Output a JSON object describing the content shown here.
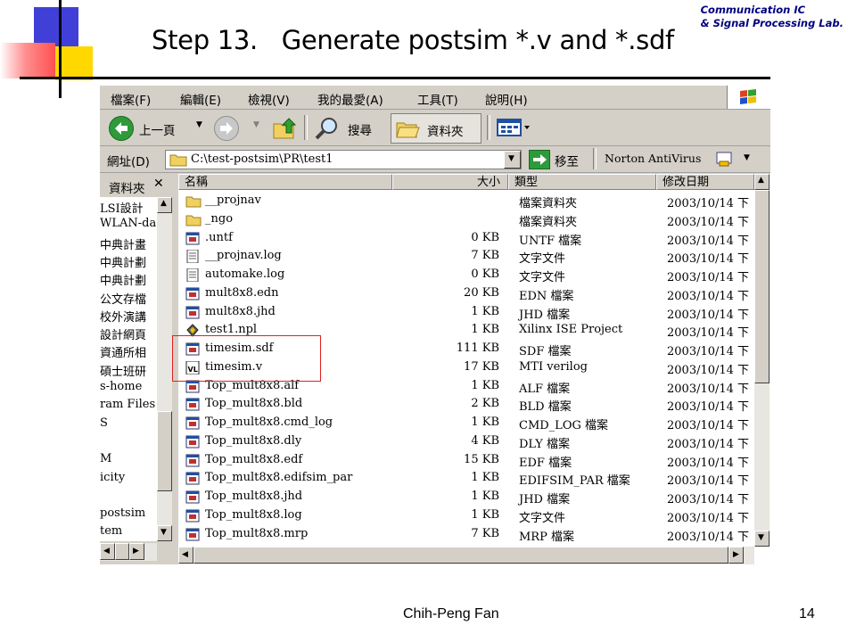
{
  "slide": {
    "title": "Step 13.   Generate postsim *.v and *.sdf",
    "lab_line1": "Communication IC",
    "lab_line2": "& Signal Processing Lab.",
    "author": "Chih-Peng Fan",
    "page_number": "14"
  },
  "colors": {
    "logo_red": "#ff5050",
    "logo_yellow": "#ffd800",
    "logo_blue": "#4040d8",
    "lab_text": "#000080",
    "highlight": "#e02020",
    "window_bg": "#d4d0c8"
  },
  "window": {
    "menu": [
      "檔案(F)",
      "編輯(E)",
      "檢視(V)",
      "我的最愛(A)",
      "工具(T)",
      "說明(H)"
    ],
    "toolbar": {
      "back": "上一頁",
      "search": "搜尋",
      "folders": "資料夾"
    },
    "address": {
      "label": "網址(D)",
      "path": "C:\\test-postsim\\PR\\test1",
      "go": "移至",
      "antivirus": "Norton AntiVirus"
    },
    "folder_pane": {
      "title": "資料夾",
      "items": [
        "LSI設計",
        "WLAN-da",
        "中典計畫",
        "中典計劃",
        "中典計劃",
        "公文存檔",
        "校外演講",
        "設計網頁",
        "資通所相",
        "碩士班研",
        "s-home",
        "ram Files",
        "S",
        "",
        "M",
        "icity",
        "",
        "postsim",
        "tem"
      ]
    },
    "columns": {
      "name": "名稱",
      "size": "大小",
      "type": "類型",
      "modified": "修改日期"
    },
    "files": [
      {
        "name": "__projnav",
        "size": "",
        "type": "檔案資料夾",
        "date": "2003/10/14 下",
        "icon": "folder-icon"
      },
      {
        "name": "_ngo",
        "size": "",
        "type": "檔案資料夾",
        "date": "2003/10/14 下",
        "icon": "folder-icon"
      },
      {
        "name": ".untf",
        "size": "0 KB",
        "type": "UNTF 檔案",
        "date": "2003/10/14 下",
        "icon": "file-icon"
      },
      {
        "name": "__projnav.log",
        "size": "7 KB",
        "type": "文字文件",
        "date": "2003/10/14 下",
        "icon": "text-file-icon"
      },
      {
        "name": "automake.log",
        "size": "0 KB",
        "type": "文字文件",
        "date": "2003/10/14 下",
        "icon": "text-file-icon"
      },
      {
        "name": "mult8x8.edn",
        "size": "20 KB",
        "type": "EDN 檔案",
        "date": "2003/10/14 下",
        "icon": "file-icon"
      },
      {
        "name": "mult8x8.jhd",
        "size": "1 KB",
        "type": "JHD 檔案",
        "date": "2003/10/14 下",
        "icon": "file-icon"
      },
      {
        "name": "test1.npl",
        "size": "1 KB",
        "type": "Xilinx ISE Project",
        "date": "2003/10/14 下",
        "icon": "ise-project-icon"
      },
      {
        "name": "timesim.sdf",
        "size": "111 KB",
        "type": "SDF 檔案",
        "date": "2003/10/14 下",
        "icon": "file-icon"
      },
      {
        "name": "timesim.v",
        "size": "17 KB",
        "type": "MTI verilog",
        "date": "2003/10/14 下",
        "icon": "verilog-file-icon"
      },
      {
        "name": "Top_mult8x8.alf",
        "size": "1 KB",
        "type": "ALF 檔案",
        "date": "2003/10/14 下",
        "icon": "file-icon"
      },
      {
        "name": "Top_mult8x8.bld",
        "size": "2 KB",
        "type": "BLD 檔案",
        "date": "2003/10/14 下",
        "icon": "file-icon"
      },
      {
        "name": "Top_mult8x8.cmd_log",
        "size": "1 KB",
        "type": "CMD_LOG 檔案",
        "date": "2003/10/14 下",
        "icon": "file-icon"
      },
      {
        "name": "Top_mult8x8.dly",
        "size": "4 KB",
        "type": "DLY 檔案",
        "date": "2003/10/14 下",
        "icon": "file-icon"
      },
      {
        "name": "Top_mult8x8.edf",
        "size": "15 KB",
        "type": "EDF 檔案",
        "date": "2003/10/14 下",
        "icon": "file-icon"
      },
      {
        "name": "Top_mult8x8.edifsim_par",
        "size": "1 KB",
        "type": "EDIFSIM_PAR 檔案",
        "date": "2003/10/14 下",
        "icon": "file-icon"
      },
      {
        "name": "Top_mult8x8.jhd",
        "size": "1 KB",
        "type": "JHD 檔案",
        "date": "2003/10/14 下",
        "icon": "file-icon"
      },
      {
        "name": "Top_mult8x8.log",
        "size": "1 KB",
        "type": "文字文件",
        "date": "2003/10/14 下",
        "icon": "file-icon"
      },
      {
        "name": "Top_mult8x8.mrp",
        "size": "7 KB",
        "type": "MRP 檔案",
        "date": "2003/10/14 下",
        "icon": "file-icon"
      }
    ]
  }
}
